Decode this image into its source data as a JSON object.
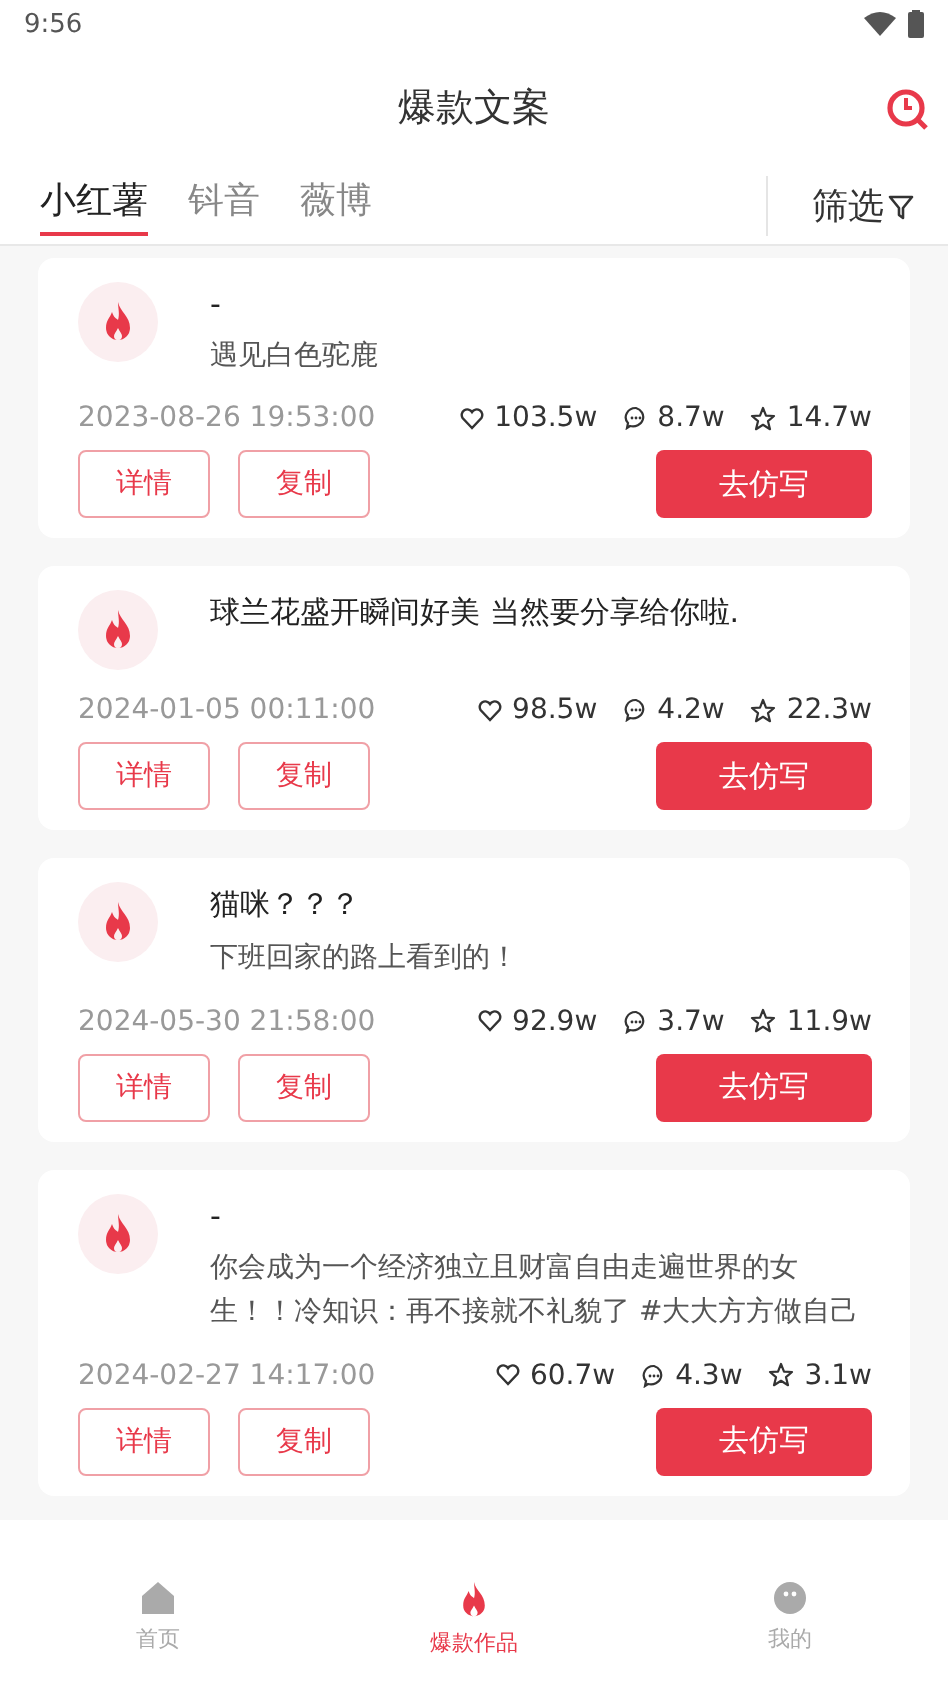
{
  "status_bar": {
    "time": "9:56"
  },
  "header": {
    "title": "爆款文案"
  },
  "tabs": [
    {
      "label": "小红薯",
      "selected": true
    },
    {
      "label": "钭音",
      "selected": false
    },
    {
      "label": "薇博",
      "selected": false
    }
  ],
  "filter": {
    "label": "筛选"
  },
  "posts": [
    {
      "title": "-",
      "text": "遇见白色驼鹿",
      "date": "2023-08-26 19:53:00",
      "likes": "103.5w",
      "comments": "8.7w",
      "stars": "14.7w",
      "buttons": [
        "详情",
        "复制"
      ],
      "action": "去仿写"
    },
    {
      "title": "球兰花盛开瞬间好美 当然要分享给你啦.",
      "date": "2024-01-05 00:11:00",
      "likes": "98.5w",
      "comments": "4.2w",
      "stars": "22.3w",
      "buttons": [
        "详情",
        "复制"
      ],
      "action": "去仿写"
    },
    {
      "title": "猫咪？？？",
      "text": "下班回家的路上看到的！",
      "date": "2024-05-30 21:58:00",
      "likes": "92.9w",
      "comments": "3.7w",
      "stars": "11.9w",
      "buttons": [
        "详情",
        "复制"
      ],
      "action": "去仿写"
    },
    {
      "title": "-",
      "text": "你会成为一个经济独立且财富自由走遍世界的女生！！冷知识：再不接就不礼貌了 #大大方方做自己",
      "date": "2024-02-27 14:17:00",
      "likes": "60.7w",
      "comments": "4.3w",
      "stars": "3.1w",
      "buttons": [
        "详情",
        "复制"
      ],
      "action": "去仿写"
    }
  ],
  "nav": [
    {
      "label": "首页",
      "kind": "home",
      "selected": false
    },
    {
      "label": "爆款作品",
      "kind": "fire",
      "selected": true
    },
    {
      "label": "我的",
      "kind": "face",
      "selected": false
    }
  ]
}
